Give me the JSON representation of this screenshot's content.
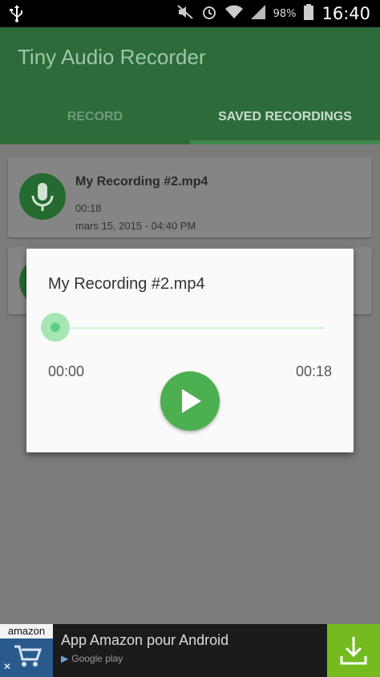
{
  "status_bar": {
    "left_icon": "usb-icon",
    "battery_percent": "98%",
    "time": "16:40",
    "icons": [
      "mute-icon",
      "alarm-icon",
      "wifi-icon",
      "signal-icon",
      "battery-icon"
    ]
  },
  "app_bar": {
    "title": "Tiny Audio Recorder",
    "tabs": [
      {
        "label": "RECORD",
        "active": false
      },
      {
        "label": "SAVED RECORDINGS",
        "active": true
      }
    ]
  },
  "recordings": [
    {
      "title": "My Recording #2.mp4",
      "duration": "00:18",
      "date": "mars 15, 2015 - 04:40 PM"
    }
  ],
  "dialog": {
    "title": "My Recording #2.mp4",
    "elapsed": "00:00",
    "total": "00:18",
    "progress": 0
  },
  "ad": {
    "brand": "amazon",
    "title": "App Amazon pour Android",
    "subtitle": "Google play"
  },
  "colors": {
    "app_bar": "#2e6b3a",
    "accent": "#4caf50",
    "ad_download": "#74bb1f"
  }
}
